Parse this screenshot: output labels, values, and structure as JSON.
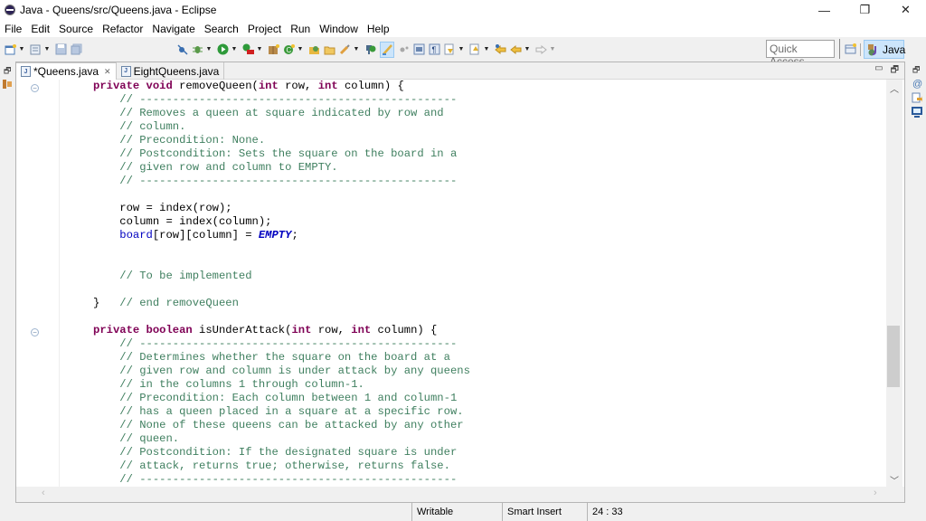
{
  "window": {
    "title": "Java - Queens/src/Queens.java - Eclipse",
    "controls": {
      "minimize": "—",
      "restore": "❐",
      "close": "✕"
    }
  },
  "menubar": [
    "File",
    "Edit",
    "Source",
    "Refactor",
    "Navigate",
    "Search",
    "Project",
    "Run",
    "Window",
    "Help"
  ],
  "toolbar": {
    "quick_access_placeholder": "Quick Access",
    "perspective_label": "Java",
    "icons": [
      "new-icon",
      "new-type-icon",
      "save-icon",
      "save-all-icon",
      "skip-breakpoints-icon",
      "debug-icon",
      "run-icon",
      "external-tools-icon",
      "new-java-package-icon",
      "new-java-class-icon",
      "open-type-icon",
      "open-task-icon",
      "search-icon",
      "open-perspective-icon",
      "toggle-mark-occurrences-icon",
      "toggle-block-selection-icon",
      "show-whitespace-icon",
      "next-annotation-icon",
      "previous-annotation-icon",
      "last-edit-location-icon",
      "back-icon",
      "forward-icon"
    ]
  },
  "editor": {
    "tabs": [
      {
        "label": "*Queens.java",
        "active": true,
        "closable": true
      },
      {
        "label": "EightQueens.java",
        "active": false,
        "closable": false
      }
    ],
    "lines": [
      [
        {
          "t": "private void ",
          "c": "kw"
        },
        {
          "t": "removeQueen(",
          "c": ""
        },
        {
          "t": "int",
          "c": "kw"
        },
        {
          "t": " row, ",
          "c": ""
        },
        {
          "t": "int",
          "c": "kw"
        },
        {
          "t": " column) {",
          "c": ""
        }
      ],
      [
        {
          "t": "    // ------------------------------------------------",
          "c": "cm"
        }
      ],
      [
        {
          "t": "    // Removes a queen at square indicated by row and",
          "c": "cm"
        }
      ],
      [
        {
          "t": "    // column.",
          "c": "cm"
        }
      ],
      [
        {
          "t": "    // Precondition: None.",
          "c": "cm"
        }
      ],
      [
        {
          "t": "    // Postcondition: Sets the square on the board in a",
          "c": "cm"
        }
      ],
      [
        {
          "t": "    // given row and column to EMPTY.",
          "c": "cm"
        }
      ],
      [
        {
          "t": "    // ------------------------------------------------",
          "c": "cm"
        }
      ],
      [
        {
          "t": "",
          "c": ""
        }
      ],
      [
        {
          "t": "    row = index(row);",
          "c": ""
        }
      ],
      [
        {
          "t": "    column = index(column);",
          "c": ""
        }
      ],
      [
        {
          "t": "    board",
          "c": "fd"
        },
        {
          "t": "[row][column] = ",
          "c": ""
        },
        {
          "t": "EMPTY",
          "c": "st"
        },
        {
          "t": ";",
          "c": ""
        }
      ],
      [
        {
          "t": "",
          "c": ""
        }
      ],
      [
        {
          "t": "",
          "c": ""
        }
      ],
      [
        {
          "t": "    // To be implemented",
          "c": "cm"
        }
      ],
      [
        {
          "t": "",
          "c": ""
        }
      ],
      [
        {
          "t": "}   ",
          "c": ""
        },
        {
          "t": "// end removeQueen",
          "c": "cm"
        }
      ],
      [
        {
          "t": "",
          "c": ""
        }
      ],
      [
        {
          "t": "private boolean ",
          "c": "kw"
        },
        {
          "t": "isUnderAttack(",
          "c": ""
        },
        {
          "t": "int",
          "c": "kw"
        },
        {
          "t": " row, ",
          "c": ""
        },
        {
          "t": "int",
          "c": "kw"
        },
        {
          "t": " column) {",
          "c": ""
        }
      ],
      [
        {
          "t": "    // ------------------------------------------------",
          "c": "cm"
        }
      ],
      [
        {
          "t": "    // Determines whether the square on the board at a",
          "c": "cm"
        }
      ],
      [
        {
          "t": "    // given row and column is under attack by any queens",
          "c": "cm"
        }
      ],
      [
        {
          "t": "    // in the columns 1 through column-1.",
          "c": "cm"
        }
      ],
      [
        {
          "t": "    // Precondition: Each column between 1 and column-1",
          "c": "cm"
        }
      ],
      [
        {
          "t": "    // has a queen placed in a square at a specific row.",
          "c": "cm"
        }
      ],
      [
        {
          "t": "    // None of these queens can be attacked by any other",
          "c": "cm"
        }
      ],
      [
        {
          "t": "    // queen.",
          "c": "cm"
        }
      ],
      [
        {
          "t": "    // Postcondition: If the designated square is under",
          "c": "cm"
        }
      ],
      [
        {
          "t": "    // attack, returns true; otherwise, returns false.",
          "c": "cm"
        }
      ],
      [
        {
          "t": "    // ------------------------------------------------",
          "c": "cm"
        }
      ]
    ]
  },
  "statusbar": {
    "writable": "Writable",
    "insert_mode": "Smart Insert",
    "position": "24 : 33"
  }
}
